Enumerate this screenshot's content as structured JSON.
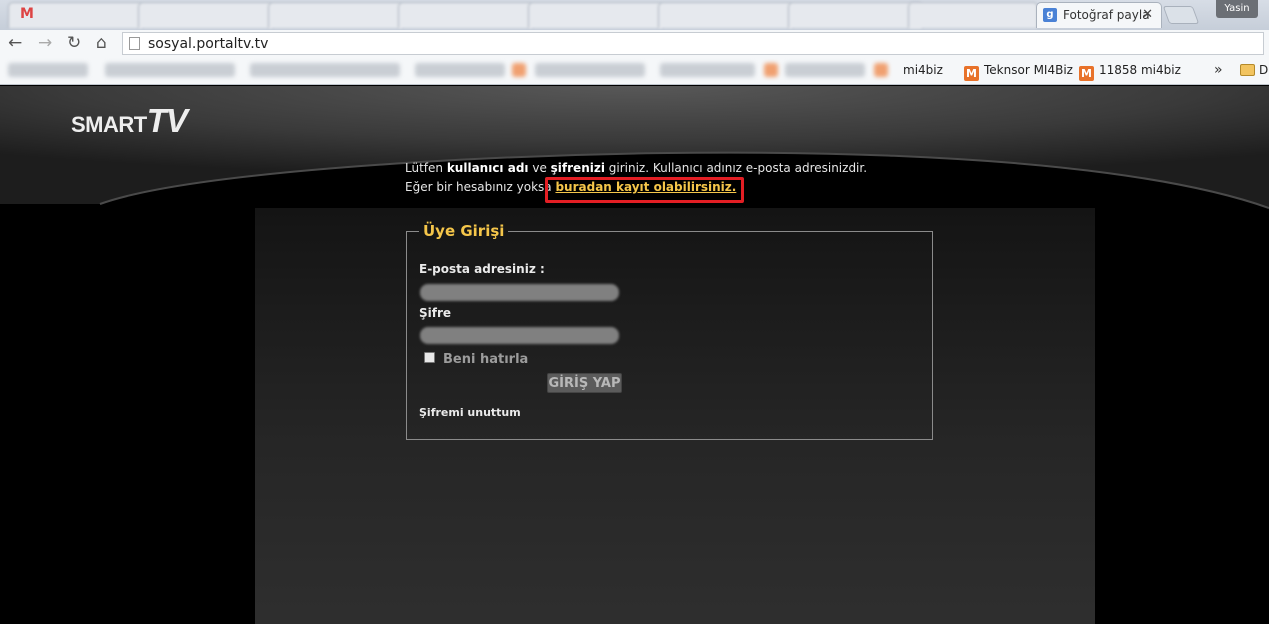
{
  "browser": {
    "tabs": [
      {
        "label": "Fotoğraf payla"
      }
    ],
    "user_label": "Yasin",
    "url": "sosyal.portaltv.tv",
    "bookmarks": [
      {
        "label": "mi4biz",
        "icon": "m-icon"
      },
      {
        "label": "Teknsor MI4Biz",
        "icon": "m-icon"
      },
      {
        "label": "11858 mi4biz",
        "icon": "m-icon"
      }
    ],
    "bookmarks_overflow": "»",
    "bookmark_folder_label": "D"
  },
  "site": {
    "logo_main": "SMART",
    "logo_tv": "TV"
  },
  "intro": {
    "l1_pre": "Lütfen ",
    "l1_b1": "kullanıcı adı",
    "l1_mid": " ve ",
    "l1_b2": "şifrenizi",
    "l1_post": " giriniz. Kullanıcı adınız e-posta adresinizdir.",
    "l2_pre": "Eğer bir hesabınız yoksa ",
    "l2_link": "buradan kayıt olabilirsiniz."
  },
  "login": {
    "legend": "Üye Girişi",
    "email_label": "E-posta adresiniz :",
    "password_label": "Şifre",
    "remember_label": "Beni hatırla",
    "submit_label": "GİRİŞ YAP",
    "forgot_label": "Şifremi unuttum"
  },
  "colors": {
    "accent": "#f5c64a",
    "highlight": "#e31e24",
    "page_bg": "#000000"
  }
}
